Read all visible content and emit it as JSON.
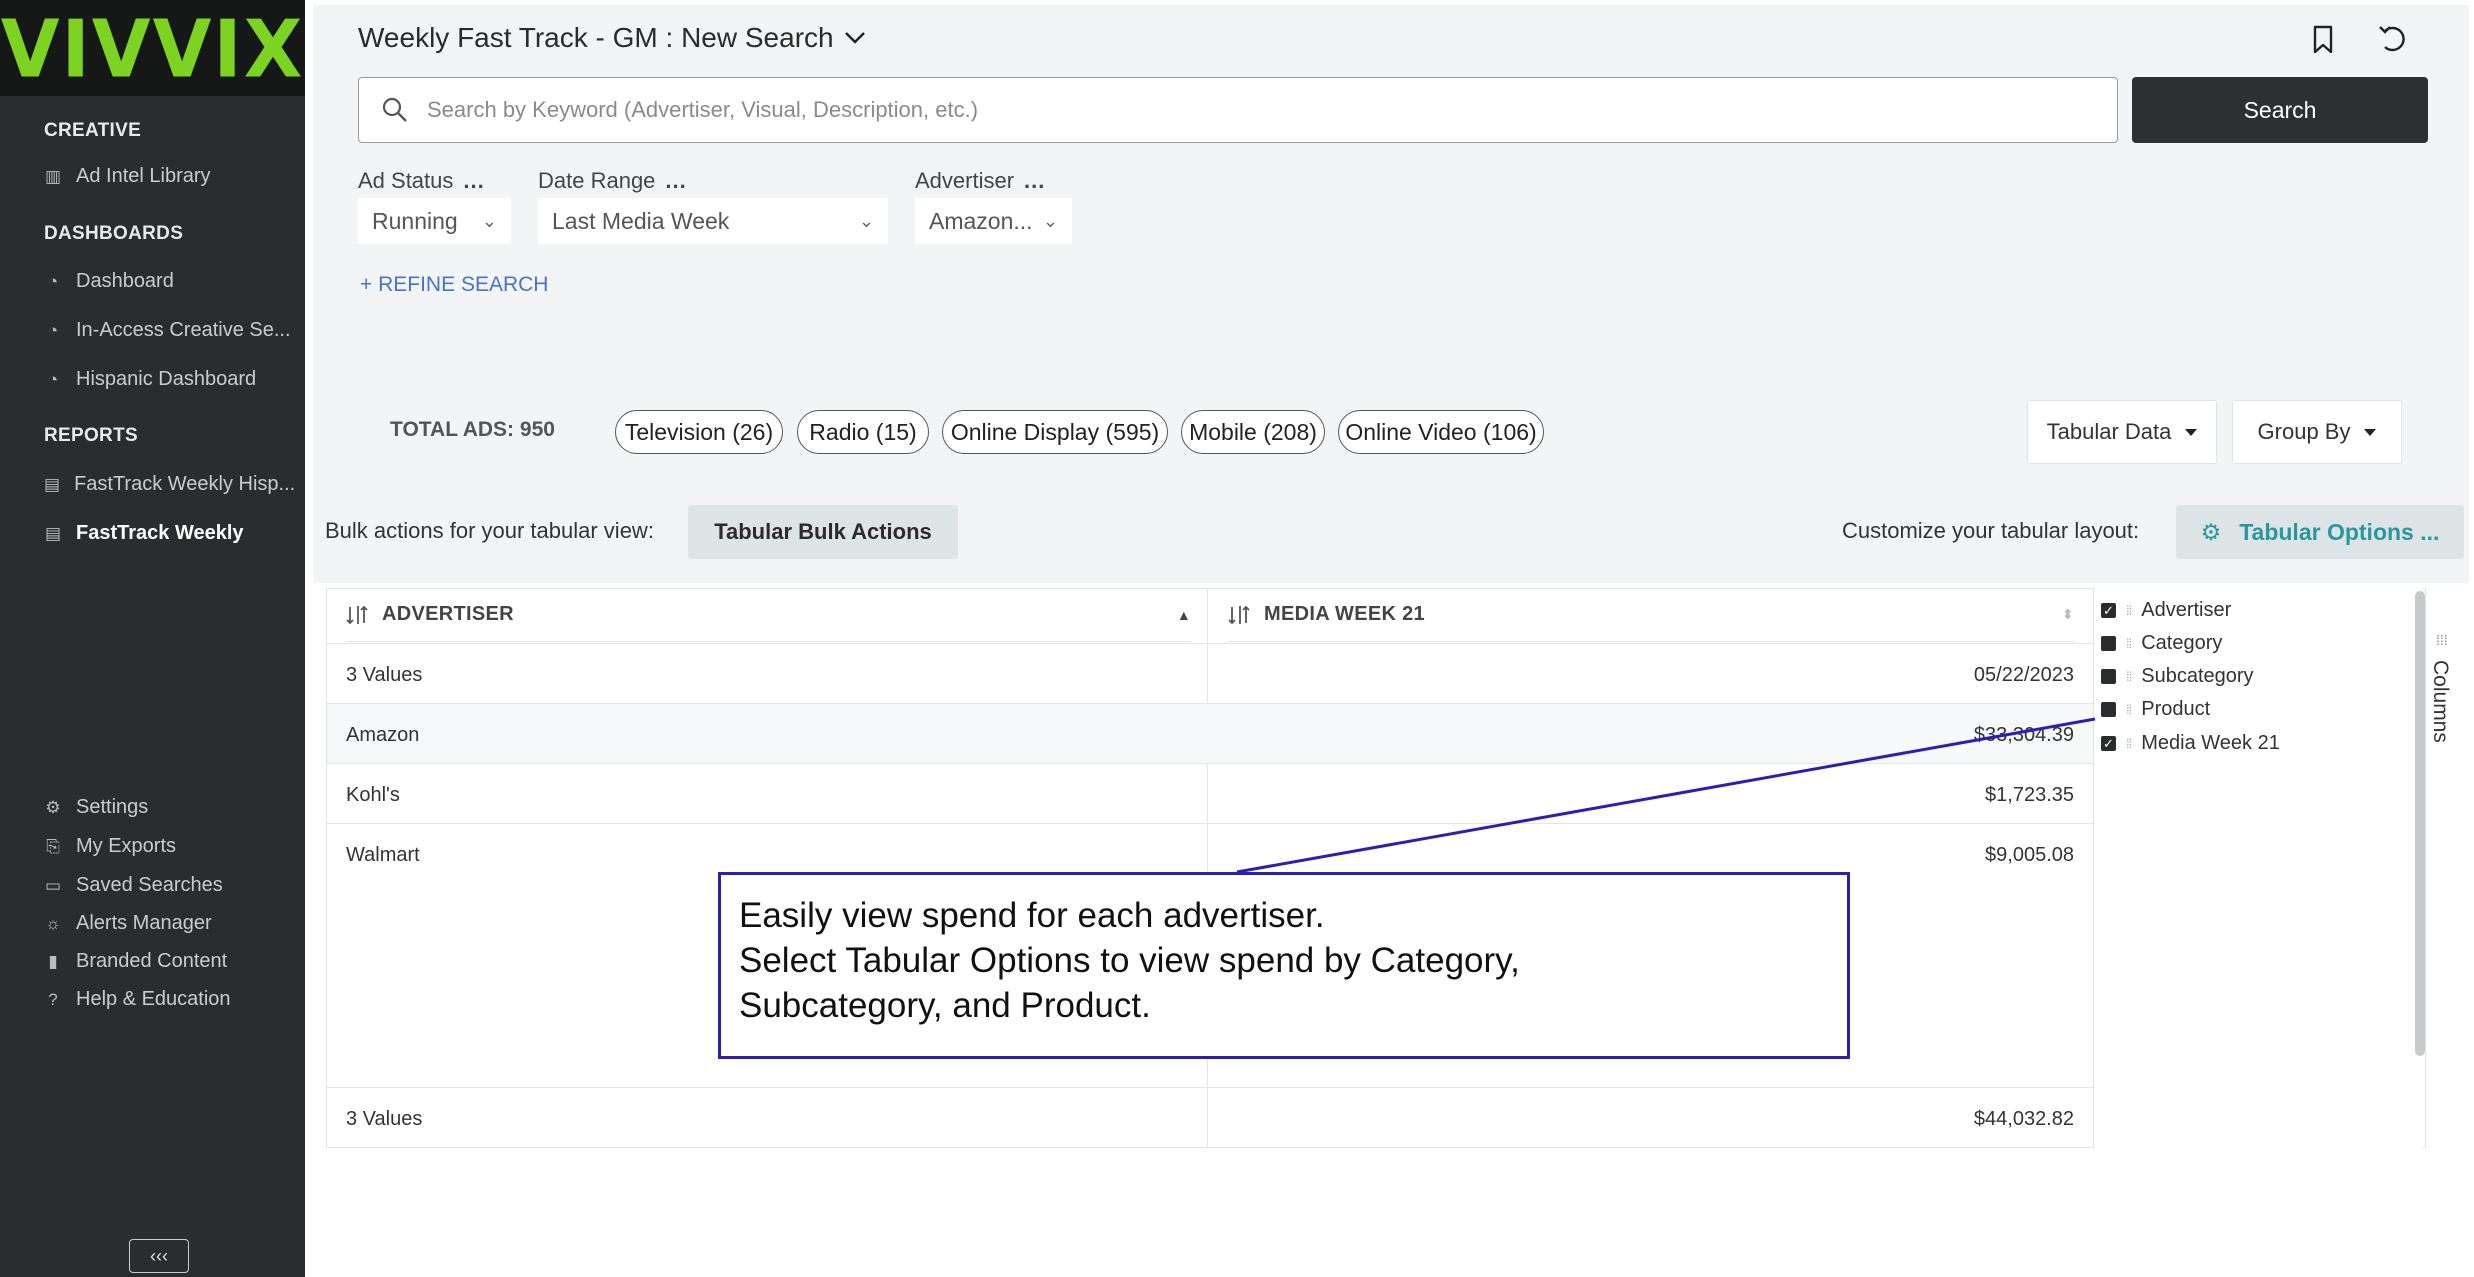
{
  "sidebar": {
    "logo": "VIVVIX",
    "sections": {
      "creative": "CREATIVE",
      "dashboards": "DASHBOARDS",
      "reports": "REPORTS"
    },
    "items": {
      "ad_intel_library": "Ad Intel Library",
      "dashboard": "Dashboard",
      "in_access": "In-Access Creative Se...",
      "hispanic_dashboard": "Hispanic Dashboard",
      "fasttrack_weekly_hisp": "FastTrack Weekly Hisp...",
      "fasttrack_weekly": "FastTrack Weekly",
      "settings": "Settings",
      "my_exports": "My Exports",
      "saved_searches": "Saved Searches",
      "alerts_manager": "Alerts Manager",
      "branded_content": "Branded Content",
      "help_education": "Help & Education"
    },
    "collapse_label": "‹‹‹"
  },
  "header": {
    "title": "Weekly Fast Track - GM : New Search",
    "search_placeholder": "Search by Keyword (Advertiser, Visual, Description, etc.)",
    "search_button": "Search"
  },
  "filters": {
    "ad_status": {
      "label": "Ad Status",
      "value": "Running"
    },
    "date_range": {
      "label": "Date Range",
      "value": "Last Media Week"
    },
    "advertiser": {
      "label": "Advertiser",
      "value": "Amazon..."
    },
    "more": "...",
    "refine": "+ REFINE SEARCH"
  },
  "summary": {
    "total_ads": "TOTAL ADS: 950",
    "chips": [
      "Television (26)",
      "Radio (15)",
      "Online Display (595)",
      "Mobile (208)",
      "Online Video (106)"
    ],
    "view_select": "Tabular Data",
    "group_by": "Group By"
  },
  "bulk": {
    "text": "Bulk actions for your tabular view:",
    "button": "Tabular Bulk Actions",
    "customize_text": "Customize your tabular layout:",
    "options_button": "Tabular Options ..."
  },
  "table": {
    "headers": [
      "ADVERTISER",
      "MEDIA WEEK 21"
    ],
    "rows": [
      [
        "3 Values",
        "05/22/2023"
      ],
      [
        "Amazon",
        "$33,304.39"
      ],
      [
        "Kohl's",
        "$1,723.35"
      ],
      [
        "Walmart",
        "$9,005.08"
      ]
    ],
    "footer": [
      "3 Values",
      "$44,032.82"
    ]
  },
  "columns_panel": {
    "tab_label": "Columns",
    "options": [
      {
        "label": "Advertiser",
        "checked": true
      },
      {
        "label": "Category",
        "checked": false
      },
      {
        "label": "Subcategory",
        "checked": false
      },
      {
        "label": "Product",
        "checked": false
      },
      {
        "label": "Media Week 21",
        "checked": true
      }
    ]
  },
  "callout": {
    "lines": [
      "Easily view spend for each advertiser.",
      "Select Tabular Options to view spend by Category,",
      "Subcategory, and Product."
    ]
  },
  "colors": {
    "brand_green": "#7dd321",
    "sidebar_bg": "#2a2d2e",
    "accent_teal": "#2a97a0",
    "callout_border": "#2b1fb0"
  }
}
